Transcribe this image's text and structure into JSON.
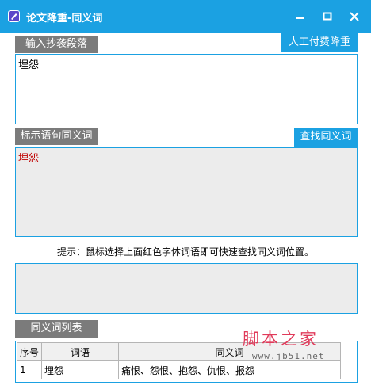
{
  "window": {
    "title": "论文降重-同义词"
  },
  "input_section": {
    "label": "输入抄袭段落",
    "action_label": "人工付费降重",
    "text": "埋怨"
  },
  "mark_section": {
    "label": "标示语句同义词",
    "action_label": "查找同义词",
    "marked_text": "埋怨",
    "marked_color": "#c00000"
  },
  "hint": {
    "text": "提示：鼠标选择上面红色字体词语即可快速查找同义词位置。"
  },
  "result_box": {
    "text": ""
  },
  "synonym_table": {
    "label": "同义词列表",
    "columns": [
      "序号",
      "词语",
      "同义词"
    ],
    "rows": [
      [
        "1",
        "埋怨",
        "痛恨、怨恨、抱怨、仇恨、报怨"
      ]
    ]
  },
  "watermark": {
    "text": "脚本之家",
    "url": "www.jb51.net"
  },
  "colors": {
    "accent": "#1ba1e2",
    "chip_gray": "#7b7b7b",
    "box_fill": "#ececec"
  },
  "icons": [
    "app-icon",
    "minimize-icon",
    "maximize-icon",
    "close-icon"
  ]
}
